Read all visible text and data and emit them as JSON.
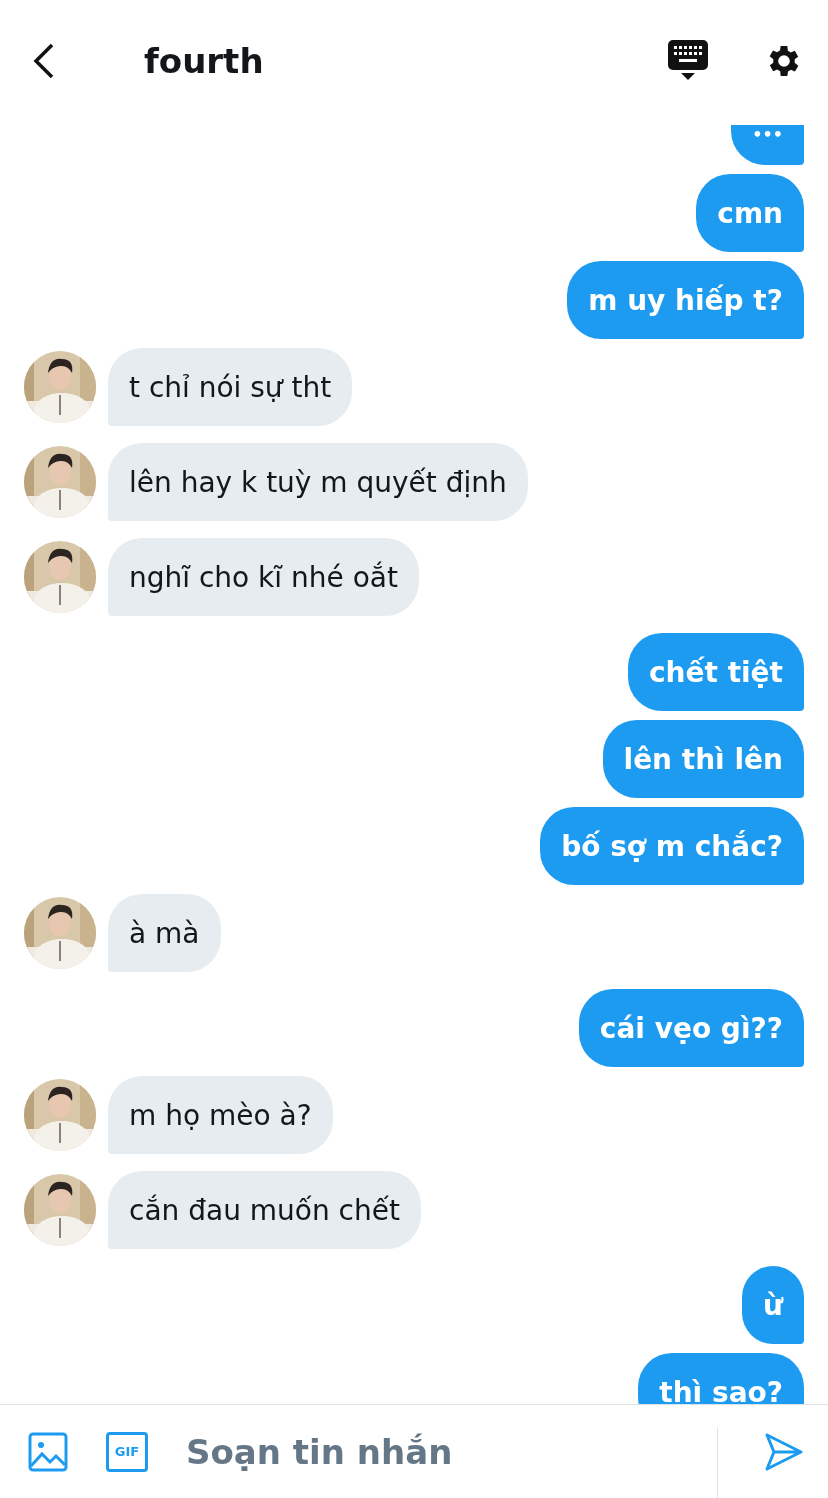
{
  "header": {
    "title": "fourth"
  },
  "messages": [
    {
      "kind": "sent",
      "text": "•••"
    },
    {
      "kind": "sent",
      "text": "cmn"
    },
    {
      "kind": "sent",
      "text": "m uy hiếp t?"
    },
    {
      "kind": "received",
      "text": "t chỉ nói sự tht"
    },
    {
      "kind": "received",
      "text": "lên hay k tuỳ m quyết định"
    },
    {
      "kind": "received",
      "text": "nghĩ cho kĩ nhé oắt"
    },
    {
      "kind": "sent",
      "text": "chết tiệt"
    },
    {
      "kind": "sent",
      "text": "lên thì lên"
    },
    {
      "kind": "sent",
      "text": "bố sợ m chắc?"
    },
    {
      "kind": "received",
      "text": "à mà"
    },
    {
      "kind": "sent",
      "text": "cái vẹo gì??"
    },
    {
      "kind": "received",
      "text": "m họ mèo à?"
    },
    {
      "kind": "received",
      "text": "cắn đau muốn chết"
    },
    {
      "kind": "sent",
      "text": "ừ"
    },
    {
      "kind": "sent",
      "text": "thì sao?"
    }
  ],
  "composer": {
    "gif_label": "GIF",
    "placeholder": "Soạn tin nhắn"
  }
}
